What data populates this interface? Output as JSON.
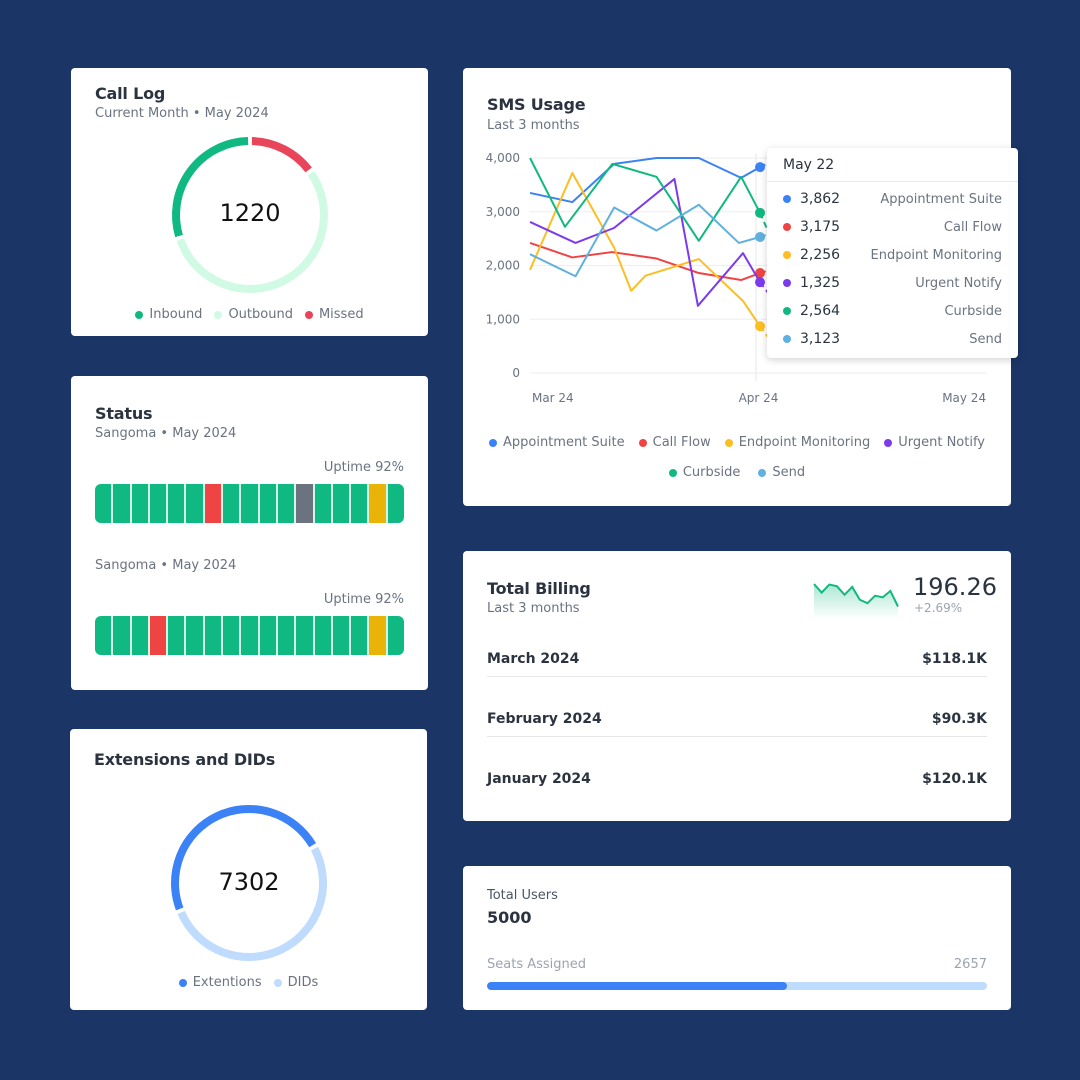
{
  "colors": {
    "background": "#1b3566",
    "green": "#10b981",
    "mint": "#d1fae5",
    "red": "#ef4444",
    "missed": "#e8445a",
    "gray": "#6b7280",
    "yellow": "#eab308",
    "blue": "#3b82f6",
    "light_blue": "#bfdbfe"
  },
  "call_log": {
    "title": "Call Log",
    "subtitle": "Current Month • May 2024",
    "total": "1220",
    "segments": [
      {
        "name": "Inbound",
        "share": 0.3,
        "color": "#10b981"
      },
      {
        "name": "Outbound",
        "share": 0.55,
        "color": "#d1fae5"
      },
      {
        "name": "Missed",
        "share": 0.15,
        "color": "#e8445a"
      }
    ],
    "legend": [
      "Inbound",
      "Outbound",
      "Missed"
    ]
  },
  "status": {
    "title": "Status",
    "blocks": [
      {
        "subtitle": "Sangoma • May 2024",
        "uptime": "Uptime 92%",
        "segments": [
          "up",
          "up",
          "up",
          "up",
          "up",
          "up",
          "down",
          "up",
          "up",
          "up",
          "up",
          "unknown",
          "up",
          "up",
          "up",
          "degraded",
          "up"
        ]
      },
      {
        "subtitle": "Sangoma • May 2024",
        "uptime": "Uptime 92%",
        "segments": [
          "up",
          "up",
          "up",
          "down",
          "up",
          "up",
          "up",
          "up",
          "up",
          "up",
          "up",
          "up",
          "up",
          "up",
          "up",
          "degraded",
          "up"
        ]
      }
    ],
    "segment_colors": {
      "up": "#10b981",
      "down": "#ef4444",
      "unknown": "#6b7280",
      "degraded": "#eab308"
    }
  },
  "extensions": {
    "title": "Extensions and DIDs",
    "total": "7302",
    "segments": [
      {
        "name": "Extentions",
        "share": 0.48,
        "color": "#3b82f6"
      },
      {
        "name": "DIDs",
        "share": 0.52,
        "color": "#bfdbfe"
      }
    ],
    "legend": [
      "Extentions",
      "DIDs"
    ]
  },
  "sms": {
    "title": "SMS Usage",
    "subtitle": "Last 3 months",
    "tooltip": {
      "date": "May 22",
      "rows": [
        {
          "value": "3,862",
          "name": "Appointment Suite",
          "color": "#3b82f6"
        },
        {
          "value": "3,175",
          "name": "Call Flow",
          "color": "#ef4444"
        },
        {
          "value": "2,256",
          "name": "Endpoint Monitoring",
          "color": "#fbbf24"
        },
        {
          "value": "1,325",
          "name": "Urgent Notify",
          "color": "#7c3aed"
        },
        {
          "value": "2,564",
          "name": "Curbside",
          "color": "#10b981"
        },
        {
          "value": "3,123",
          "name": "Send",
          "color": "#60b0e0"
        }
      ]
    }
  },
  "chart_data": {
    "type": "line",
    "title": "SMS Usage",
    "subtitle": "Last 3 months",
    "xlabel": "",
    "ylabel": "",
    "ylim": [
      0,
      4000
    ],
    "yticks": [
      "0",
      "1,000",
      "2,000",
      "3,000",
      "4,000"
    ],
    "ytick_values": [
      0,
      1000,
      2000,
      3000,
      4000
    ],
    "xticks": [
      "Mar 24",
      "Apr 24",
      "May 24"
    ],
    "xtick_positions": [
      0.05,
      0.5,
      0.95
    ],
    "hover_x": 0.5,
    "grid": true,
    "legend_position": "bottom",
    "series": [
      {
        "name": "Appointment Suite",
        "color": "#3b82f6",
        "x": [
          0.0,
          0.092,
          0.183,
          0.275,
          0.367,
          0.459,
          0.5
        ],
        "values": [
          3350,
          3180,
          3890,
          4000,
          4000,
          3630,
          3830
        ],
        "dashed_x": [
          0.5,
          0.54
        ],
        "dashed_values": [
          3830,
          4000
        ]
      },
      {
        "name": "Call Flow",
        "color": "#ef4444",
        "x": [
          0.0,
          0.092,
          0.178,
          0.275,
          0.367,
          0.459,
          0.5
        ],
        "values": [
          2420,
          2150,
          2250,
          2130,
          1860,
          1730,
          1860
        ],
        "dashed_x": [
          0.5,
          0.54
        ],
        "dashed_values": [
          1860,
          1960
        ]
      },
      {
        "name": "Endpoint Monitoring",
        "color": "#fbbf24",
        "x": [
          0.0,
          0.092,
          0.183,
          0.22,
          0.251,
          0.367,
          0.463,
          0.5
        ],
        "values": [
          1920,
          3720,
          2330,
          1530,
          1810,
          2120,
          1340,
          870
        ],
        "dashed_x": [
          0.5,
          0.55
        ],
        "dashed_values": [
          870,
          280
        ]
      },
      {
        "name": "Urgent Notify",
        "color": "#7c3aed",
        "x": [
          0.0,
          0.099,
          0.183,
          0.314,
          0.365,
          0.463,
          0.5
        ],
        "values": [
          2810,
          2420,
          2700,
          3610,
          1250,
          2230,
          1690
        ],
        "dashed_x": [
          0.5,
          0.53
        ],
        "dashed_values": [
          1690,
          1350
        ]
      },
      {
        "name": "Curbside",
        "color": "#10b981",
        "x": [
          0.0,
          0.076,
          0.179,
          0.275,
          0.367,
          0.459,
          0.5
        ],
        "values": [
          4000,
          2720,
          3890,
          3650,
          2460,
          3650,
          2980
        ],
        "dashed_x": [
          0.5,
          0.526
        ],
        "dashed_values": [
          2980,
          2470
        ]
      },
      {
        "name": "Send",
        "color": "#60b0e0",
        "x": [
          0.0,
          0.099,
          0.183,
          0.275,
          0.367,
          0.454,
          0.5
        ],
        "values": [
          2210,
          1800,
          3080,
          2650,
          3130,
          2420,
          2530
        ],
        "dashed_x": [
          0.5,
          0.53
        ],
        "dashed_values": [
          2530,
          2620
        ]
      }
    ]
  },
  "billing": {
    "title": "Total Billing",
    "subtitle": "Last 3 months",
    "value": "196.26",
    "change": "+2.69%",
    "sparkline": [
      0.86,
      0.39,
      0.83,
      0.74,
      0.27,
      0.7,
      0.0,
      -0.19,
      0.22,
      0.13,
      0.48,
      -0.37
    ],
    "rows": [
      {
        "label": "March 2024",
        "amount": "$118.1K"
      },
      {
        "label": "February 2024",
        "amount": "$90.3K"
      },
      {
        "label": "January 2024",
        "amount": "$120.1K"
      }
    ]
  },
  "users": {
    "title": "Total Users",
    "total": "5000",
    "seats_label": "Seats Assigned",
    "seats_value": "2657",
    "seats_fraction": 0.6
  }
}
